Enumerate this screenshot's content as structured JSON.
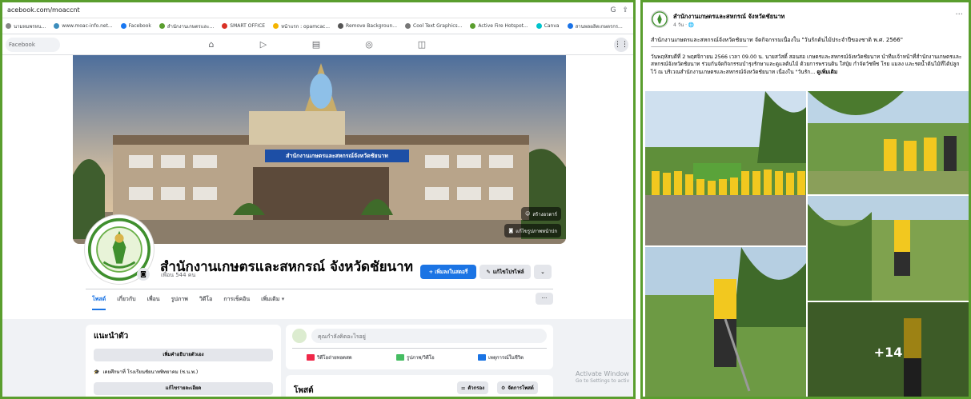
{
  "browser": {
    "url": "acebook.com/moaccnt",
    "bookmarks": [
      {
        "label": "นามหมพรหน...",
        "color": "#888888"
      },
      {
        "label": "www.moac-info.net...",
        "color": "#3c8dbc"
      },
      {
        "label": "Facebook",
        "color": "#1877f2"
      },
      {
        "label": "สำนักงานเกษตรและ...",
        "color": "#5a9e2e"
      },
      {
        "label": "SMART OFFICE",
        "color": "#d93025"
      },
      {
        "label": "หน้าแรก : opamcac...",
        "color": "#f4b400"
      },
      {
        "label": "Remove Backgroun...",
        "color": "#555555"
      },
      {
        "label": "Cool Text Graphics...",
        "color": "#777777"
      },
      {
        "label": "Active Fire Hotspot...",
        "color": "#5a9e2e"
      },
      {
        "label": "Canva",
        "color": "#00c4cc"
      },
      {
        "label": "สานพลผลิตเกษตรกร...",
        "color": "#1a73e8"
      }
    ]
  },
  "fbnav": {
    "search_placeholder": "Facebook"
  },
  "page": {
    "name": "สำนักงานเกษตรและสหกรณ์ จังหวัดชัยนาท",
    "friends": "เพื่อน 544 คน",
    "cover_sign": "สำนักงานเกษตรและสหกรณ์จังหวัดชัยนาท",
    "cover_btn_avatar": "สร้างอวตาร์",
    "cover_btn_edit": "แก้ไขรูปภาพหน้าปก",
    "btn_follow": "+ เพิ่มลงในสตอรี่",
    "btn_edit": "แก้ไขโปรไฟล์",
    "tabs": [
      "โพสต์",
      "เกี่ยวกับ",
      "เพื่อน",
      "รูปภาพ",
      "วิดีโอ",
      "การเช็คอิน",
      "เพิ่มเติม ▾"
    ],
    "intro_title": "แนะนำตัว",
    "intro_btn_bio": "เพิ่มคำอธิบายตัวเอง",
    "intro_line": "เคยศึกษาที่ โรงเรียนชัยนาทพิทยาคม (ช.น.พ.)",
    "intro_btn_edit": "แก้ไขรายละเอียด",
    "composer_placeholder": "คุณกำลังคิดอะไรอยู่",
    "composer_live": "วิดีโอถ่ายทอดสด",
    "composer_photo": "รูปภาพ/วิดีโอ",
    "composer_event": "เหตุการณ์ในชีวิต",
    "posts_title": "โพสต์",
    "posts_filter": "ตัวกรอง",
    "posts_manage": "จัดการโพสต์"
  },
  "windows_notice": {
    "title": "Activate Window",
    "sub": "Go to Settings to activ"
  },
  "post": {
    "author": "สำนักงานเกษตรและสหกรณ์ จังหวัดชัยนาท",
    "time": "4 วัน · 🌐",
    "title": "สำนักงานเกษตรและสหกรณ์จังหวัดชัยนาท จัดกิจกรรมเนื่องใน \"วันรักต้นไม้ประจำปีของชาติ พ.ศ. 2566\"",
    "separator": "-------------------------------------------------------------------------------------------------------",
    "body": "วันพฤหัสบดีที่ 2 พฤศจิกายน 2566 เวลา 09.00 น. นายสวัสดิ์ สอนสอ เกษตรและสหกรณ์จังหวัดชัยนาท นำทีมเจ้าหน้าที่สำนักงานเกษตรและสหกรณ์จังหวัดชัยนาท ร่วมกันจัดกิจกรรมบำรุงรักษาและดูแลต้นไม้ ด้วยการพรวนดิน ใส่ปุ๋ย กำจัดวัชพืช โรย แมลง และรดน้ำต้นไม้ที่ได้ปลูกไว้ ณ บริเวณสำนักงานเกษตรและสหกรณ์จังหวัดชัยนาท เนื่องใน \"วันรัก...",
    "see_more": "ดูเพิ่มเติม",
    "more_photos": "+14"
  }
}
